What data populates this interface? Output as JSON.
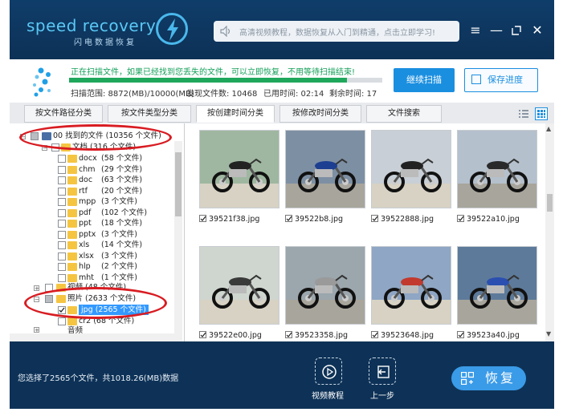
{
  "app": {
    "logo": "speed recovery",
    "logo_sub": "闪电数据恢复",
    "search_placeholder": "高清视频教程，数据恢复从入门到精通，点击立即学习!"
  },
  "scan": {
    "message": "正在扫描文件，如果已经找到您丢失的文件，可以立即恢复，不用等待扫描结束!",
    "progress": 0.887,
    "range": "扫描范围: 8872(MB)/10000(MB)",
    "found": "发现文件数: 10468",
    "elapsed": "已用时间: 02:14",
    "remaining": "剩余时间: 17",
    "continue_label": "继续扫描",
    "save_label": "保存进度"
  },
  "tabs": [
    "按文件路径分类",
    "按文件类型分类",
    "按创建时间分类",
    "按修改时间分类",
    "文件搜索"
  ],
  "active_tab": 2,
  "tree": {
    "root": "00 找到的文件 (10356 个文件)",
    "documents": "文档 (316 个文件)",
    "doc_items": [
      {
        "name": "docx",
        "count": "(58 个文件)"
      },
      {
        "name": "chm",
        "count": "(29 个文件)"
      },
      {
        "name": "doc",
        "count": "(63 个文件)"
      },
      {
        "name": "rtf",
        "count": "(20 个文件)"
      },
      {
        "name": "mpp",
        "count": "(3 个文件)"
      },
      {
        "name": "pdf",
        "count": "(102 个文件)"
      },
      {
        "name": "ppt",
        "count": "(18 个文件)"
      },
      {
        "name": "pptx",
        "count": "(3 个文件)"
      },
      {
        "name": "xls",
        "count": "(14 个文件)"
      },
      {
        "name": "xlsx",
        "count": "(3 个文件)"
      },
      {
        "name": "hlp",
        "count": "(2 个文件)"
      },
      {
        "name": "mht",
        "count": "(1 个文件)"
      }
    ],
    "video": "视频 (48 个文件)",
    "photos": "照片 (2633 个文件)",
    "jpg": "jpg (2565 个文件)",
    "cr2": "cr2 (68 个文件)",
    "partial": "音频"
  },
  "files": [
    "39521f38.jpg",
    "39522b8.jpg",
    "39522888.jpg",
    "39522a10.jpg",
    "39522e00.jpg",
    "39523358.jpg",
    "39523648.jpg",
    "39523a40.jpg"
  ],
  "footer": {
    "selection": "您选择了2565个文件，共1018.26(MB)数据",
    "video_tutorial": "视频教程",
    "back": "上一步",
    "recover": "恢复"
  },
  "colors": {
    "frame": "#0e3257",
    "accent": "#1a8fe0",
    "scan_text": "#16a05a",
    "highlight": "#3399ff",
    "annotation": "#d81c22"
  }
}
